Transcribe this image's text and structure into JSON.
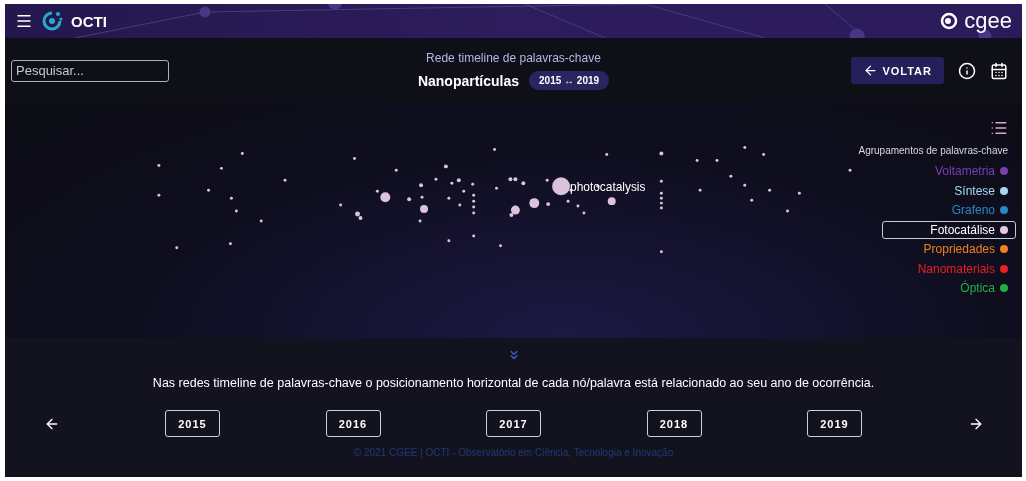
{
  "header": {
    "logo_text": "OCTI",
    "brand": "cgee"
  },
  "search": {
    "placeholder": "Pesquisar..."
  },
  "subtitle": "Rede timeline de palavras-chave",
  "title": "Nanopartículas",
  "range": "2015 ↔ 2019",
  "back_button": "VOLTAR",
  "network": {
    "node_label": "photocatalysis"
  },
  "legend": {
    "title": "Agrupamentos de palavras-chave",
    "items": [
      {
        "label": "Voltametria",
        "color": "#7b3fb0",
        "selected": false
      },
      {
        "label": "Síntese",
        "color": "#a8d8f0",
        "selected": false
      },
      {
        "label": "Grafeno",
        "color": "#2a86c8",
        "selected": false
      },
      {
        "label": "Fotocatálise",
        "color": "#e3c9e3",
        "selected": true
      },
      {
        "label": "Propriedades",
        "color": "#f08020",
        "selected": false
      },
      {
        "label": "Nanomateriais",
        "color": "#e82020",
        "selected": false
      },
      {
        "label": "Óptica",
        "color": "#20b040",
        "selected": false
      }
    ]
  },
  "caption": "Nas redes timeline de palavras-chave o posicionamento horizontal de cada nó/palavra está relacionado ao seu ano de ocorrência.",
  "years": [
    "2015",
    "2016",
    "2017",
    "2018",
    "2019"
  ],
  "footer": "© 2021 CGEE | OCTI - Observatório em Ciência, Tecnologia e Inovação"
}
